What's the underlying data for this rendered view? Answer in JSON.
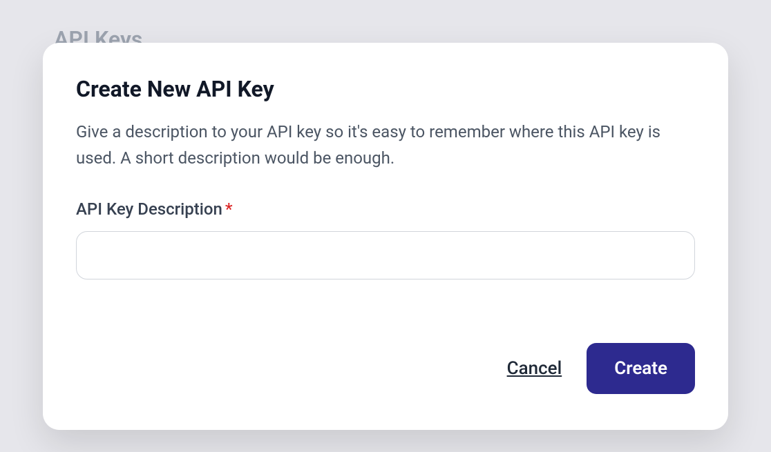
{
  "page": {
    "header": "API Keys"
  },
  "modal": {
    "title": "Create New API Key",
    "description": "Give a description to your API key so it's easy to remember where this API key is used. A short description would be enough.",
    "field": {
      "label": "API Key Description",
      "required_mark": "*",
      "value": "",
      "placeholder": ""
    },
    "buttons": {
      "cancel": "Cancel",
      "create": "Create"
    }
  },
  "colors": {
    "primary": "#2d2a8f",
    "required": "#dc2626",
    "text_muted": "#4b5563",
    "text_dark": "#111827",
    "background": "#e6e6eb"
  }
}
